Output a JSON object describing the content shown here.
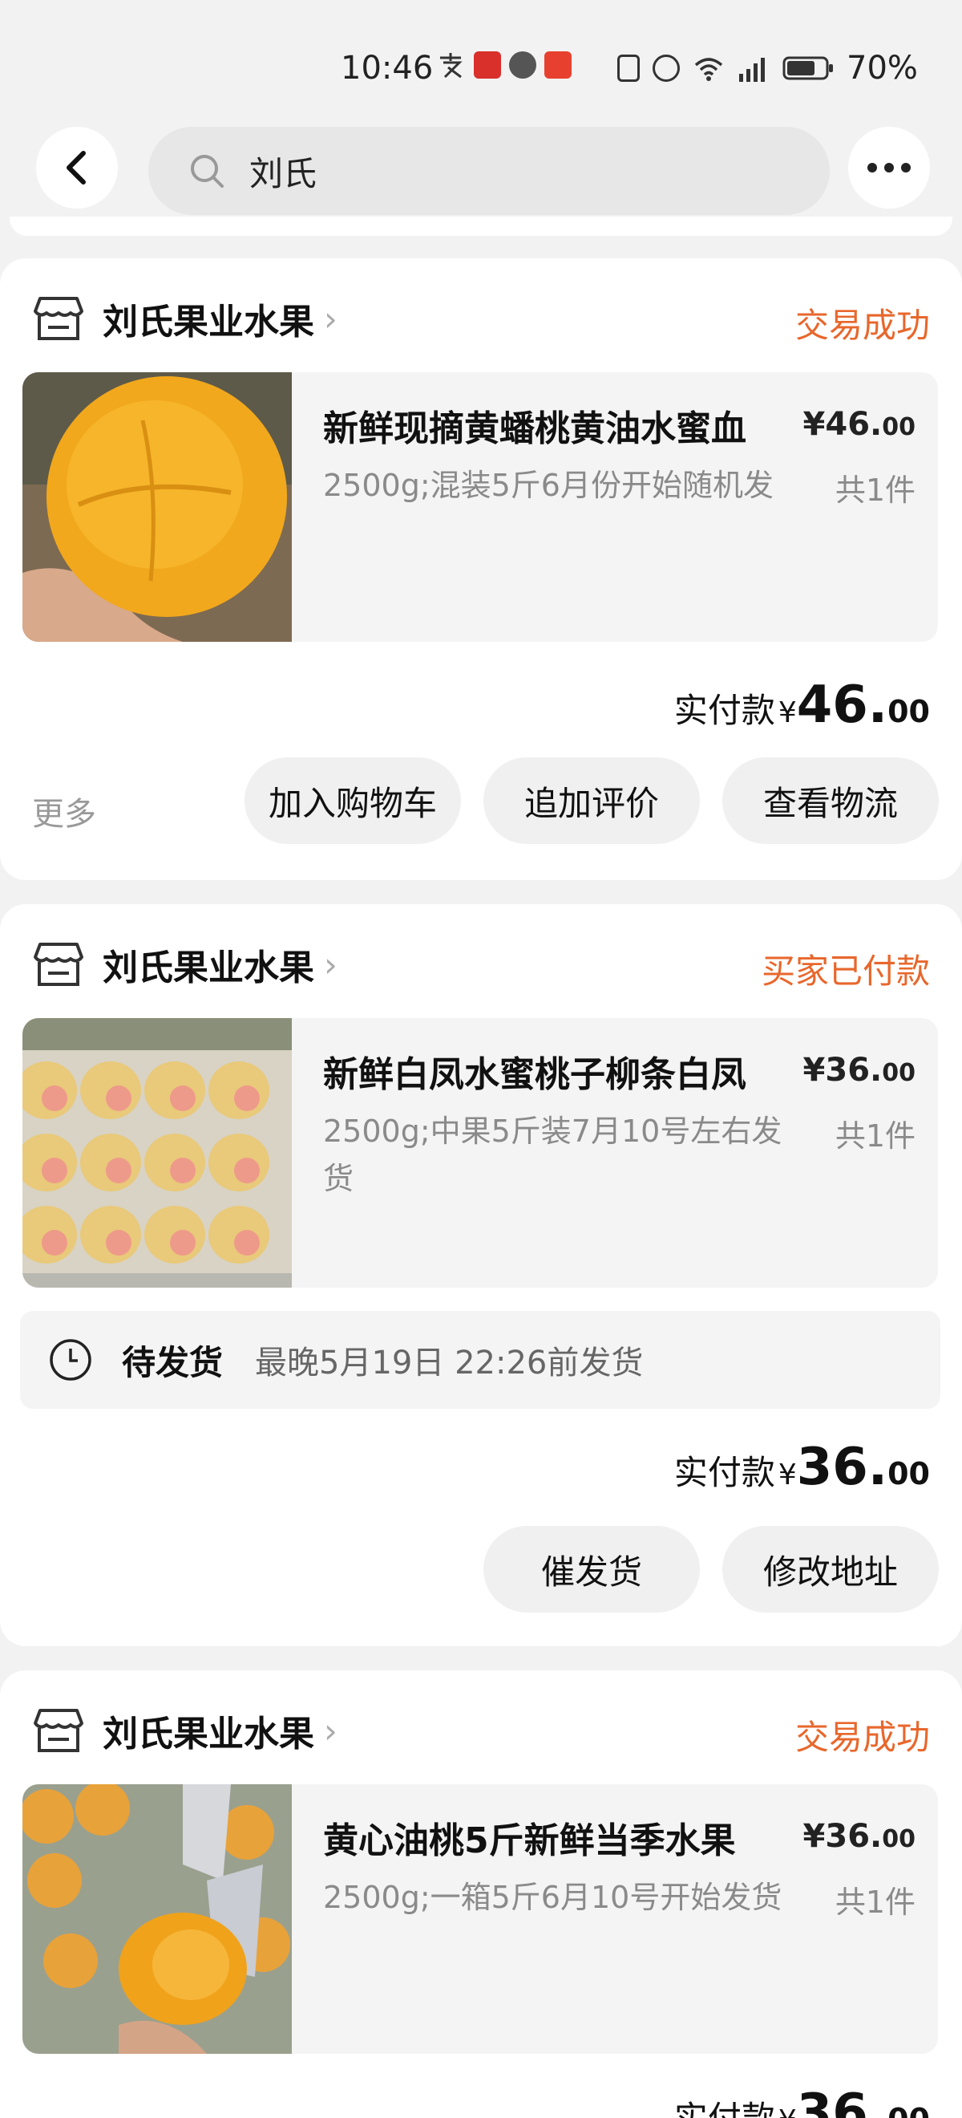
{
  "status_bar": {
    "time": "10:46",
    "battery": "70%"
  },
  "header": {
    "search_query": "刘氏"
  },
  "orders": [
    {
      "shop_name": "刘氏果业水果",
      "status": "交易成功",
      "product_title": "新鲜现摘黄蟠桃黄油水蜜血",
      "price_int": "¥46.",
      "price_dec": "00",
      "spec": "2500g;混装5斤6月份开始随机发",
      "qty": "共1件",
      "paid_label": "实付款",
      "paid_yen": "¥",
      "paid_int": "46.",
      "paid_dec": "00",
      "more": "更多",
      "buttons": [
        "加入购物车",
        "追加评价",
        "查看物流"
      ]
    },
    {
      "shop_name": "刘氏果业水果",
      "status": "买家已付款",
      "product_title": "新鲜白凤水蜜桃子柳条白凤",
      "price_int": "¥36.",
      "price_dec": "00",
      "spec": "2500g;中果5斤装7月10号左右发货",
      "qty": "共1件",
      "ship_label": "待发货",
      "ship_text": "最晚5月19日 22:26前发货",
      "paid_label": "实付款",
      "paid_yen": "¥",
      "paid_int": "36.",
      "paid_dec": "00",
      "buttons": [
        "催发货",
        "修改地址"
      ]
    },
    {
      "shop_name": "刘氏果业水果",
      "status": "交易成功",
      "product_title": "黄心油桃5斤新鲜当季水果",
      "price_int": "¥36.",
      "price_dec": "00",
      "spec": "2500g;一箱5斤6月10号开始发货",
      "qty": "共1件",
      "paid_label": "实付款",
      "paid_yen": "¥",
      "paid_int": "36.",
      "paid_dec": "00"
    }
  ],
  "colors": {
    "accent": "#e8672c",
    "card_bg": "#ffffff",
    "page_bg": "#f2f2f2"
  }
}
